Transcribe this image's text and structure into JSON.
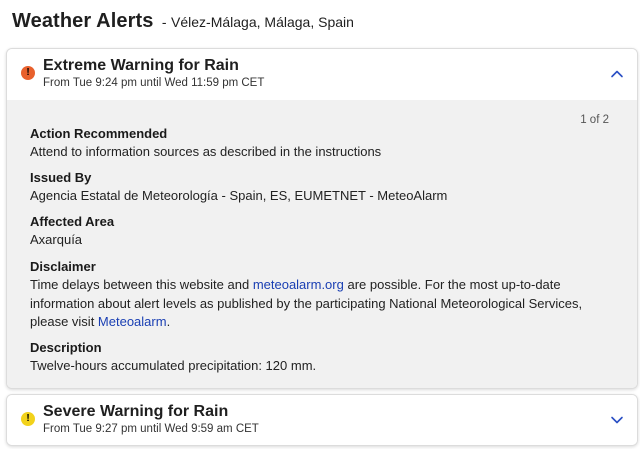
{
  "header": {
    "title": "Weather Alerts",
    "separator": "-",
    "location": "Vélez-Málaga, Málaga, Spain"
  },
  "alerts": [
    {
      "title": "Extreme Warning for Rain",
      "time": "From Tue 9:24 pm until Wed 11:59 pm CET",
      "severity_color": "#e8602c",
      "icon": "exclamation-icon",
      "expanded": true,
      "chevron": "chevron-up-icon",
      "pagination": "1 of 2",
      "sections": {
        "action": {
          "label": "Action Recommended",
          "text": "Attend to information sources as described in the instructions"
        },
        "issued": {
          "label": "Issued By",
          "text": "Agencia Estatal de Meteorología - Spain, ES, EUMETNET - MeteoAlarm"
        },
        "area": {
          "label": "Affected Area",
          "text": "Axarquía"
        },
        "disclaimer": {
          "label": "Disclaimer",
          "text_before": "Time delays between this website and ",
          "link1": "meteoalarm.org",
          "text_middle": " are possible. For the most up-to-date information about alert levels as published by the participating National Meteorological Services, please visit ",
          "link2": "Meteoalarm",
          "text_after": "."
        },
        "description": {
          "label": "Description",
          "text": "Twelve-hours accumulated precipitation: 120 mm."
        }
      }
    },
    {
      "title": "Severe Warning for Rain",
      "time": "From Tue 9:27 pm until Wed 9:59 am CET",
      "severity_color": "#f2d21b",
      "icon": "exclamation-icon",
      "expanded": false,
      "chevron": "chevron-down-icon"
    }
  ],
  "colors": {
    "accent": "#1a3fb3",
    "panel_bg": "#f1f1f1"
  }
}
